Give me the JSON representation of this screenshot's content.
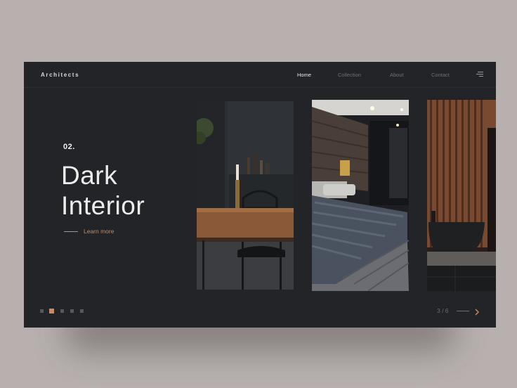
{
  "header": {
    "logo": "Architects",
    "nav": [
      {
        "label": "Home",
        "active": true
      },
      {
        "label": "Collection",
        "active": false
      },
      {
        "label": "About",
        "active": false
      },
      {
        "label": "Contact",
        "active": false
      }
    ],
    "menu_icon": "hamburger-menu-icon"
  },
  "hero": {
    "number": "02.",
    "title_line1": "Dark",
    "title_line2": "Interior",
    "link_label": "Learn more"
  },
  "gallery": [
    {
      "name": "dining-room-photo"
    },
    {
      "name": "bedroom-photo"
    },
    {
      "name": "bathroom-photo"
    }
  ],
  "pagination": {
    "dots": 5,
    "active_dot": 2,
    "counter": "3 / 6",
    "next_icon": "chevron-right-icon"
  },
  "colors": {
    "background": "#b7b0ae",
    "panel": "#222428",
    "accent": "#c98a66",
    "text": "#ececec",
    "muted": "#6e7076"
  }
}
